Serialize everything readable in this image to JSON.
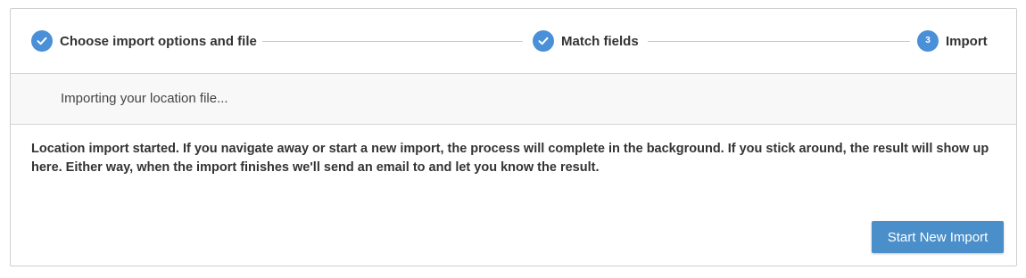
{
  "stepper": {
    "steps": [
      {
        "label": "Choose import options and file",
        "state": "complete",
        "icon": "check-icon"
      },
      {
        "label": "Match fields",
        "state": "complete",
        "icon": "check-icon"
      },
      {
        "number": "3",
        "label": "Import",
        "state": "current"
      }
    ]
  },
  "status": {
    "text": "Importing your location file..."
  },
  "message": {
    "text": "Location import started. If you navigate away or start a new import, the process will complete in the background. If you stick around, the result will show up here. Either way, when the import finishes we'll send an email to and let you know the result."
  },
  "actions": {
    "start_new_import_label": "Start New Import"
  },
  "colors": {
    "accent": "#4a90d9",
    "button": "#4a8fc9",
    "status_bg": "#f8f8f8"
  }
}
